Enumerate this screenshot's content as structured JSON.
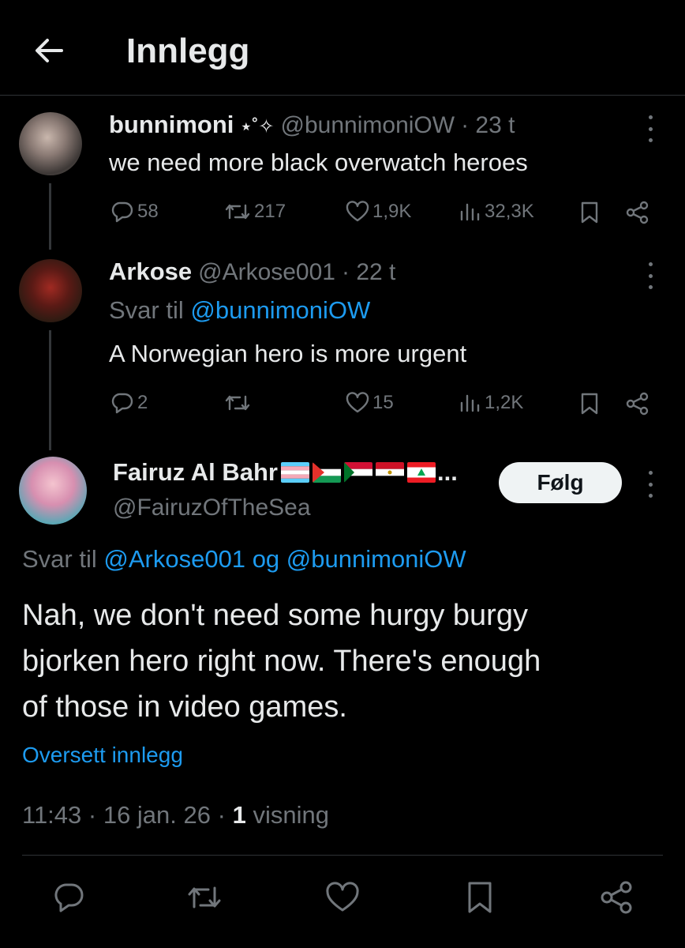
{
  "header": {
    "title": "Innlegg"
  },
  "tweets": [
    {
      "name": "bunnimoni",
      "name_symbols": "⋆˚✧",
      "handle": "@bunnimoniOW",
      "time": "· 23 t",
      "text": "we need more black overwatch heroes",
      "stats": {
        "replies": "58",
        "reposts": "217",
        "likes": "1,9K",
        "views": "32,3K"
      }
    },
    {
      "name": "Arkose",
      "handle": "@Arkose001",
      "time": "· 22 t",
      "reply_prefix": "Svar til",
      "reply_to": "@bunnimoniOW",
      "text": "A Norwegian hero is more urgent",
      "stats": {
        "replies": "2",
        "reposts": "",
        "likes": "15",
        "views": "1,2K"
      }
    }
  ],
  "main": {
    "name": "Fairuz Al Bahr",
    "name_ellipsis": "...",
    "handle": "@FairuzOfTheSea",
    "follow_label": "Følg",
    "reply_prefix": "Svar til",
    "reply_to_1": "@Arkose001",
    "reply_and": "og",
    "reply_to_2": "@bunnimoniOW",
    "text_lines": [
      "Nah, we don't need some hurgy burgy",
      "bjorken hero right now. There's enough",
      "of those in video games."
    ],
    "translate": "Oversett innlegg",
    "timestamp": "11:43 · 16 jan. 26 ·",
    "view_count": "1",
    "view_label": "visning"
  },
  "colors": {
    "accent": "#1d9bf0",
    "muted": "#71767b",
    "text": "#e7e9ea"
  }
}
